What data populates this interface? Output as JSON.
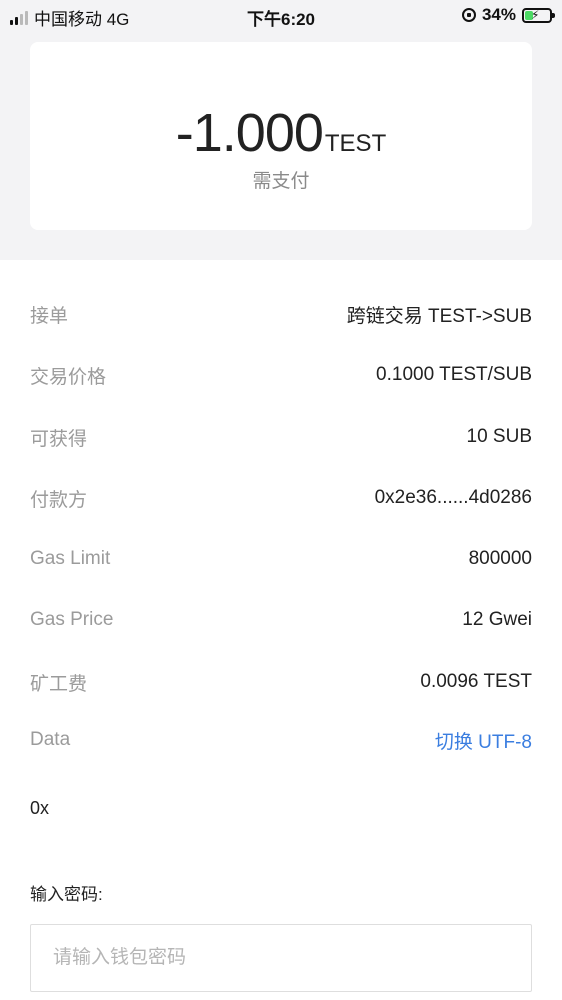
{
  "status_bar": {
    "carrier": "中国移动 4G",
    "time": "下午6:20",
    "battery": "34%",
    "battery_level": 0.34,
    "icons": [
      "signal-icon",
      "rotation-lock-icon",
      "battery-charging-icon"
    ]
  },
  "payment": {
    "amount": "-1.000",
    "unit": "TEST",
    "caption": "需支付"
  },
  "details": [
    {
      "label": "接单",
      "value": "跨链交易 TEST->SUB"
    },
    {
      "label": "交易价格",
      "value": "0.1000 TEST/SUB"
    },
    {
      "label": "可获得",
      "value": "10 SUB"
    },
    {
      "label": "付款方",
      "value": "0x2e36......4d0286"
    },
    {
      "label": "Gas Limit",
      "value": "800000"
    },
    {
      "label": "Gas Price",
      "value": "12 Gwei"
    },
    {
      "label": "矿工费",
      "value": "0.0096 TEST"
    }
  ],
  "data_field": {
    "label": "Data",
    "toggle_label": "切换 UTF-8",
    "value": "0x"
  },
  "password": {
    "label": "输入密码:",
    "placeholder": "请输入钱包密码"
  },
  "colors": {
    "link": "#3b7ee0",
    "section_bg": "#f3f3f5",
    "label": "#9b9b9b"
  }
}
